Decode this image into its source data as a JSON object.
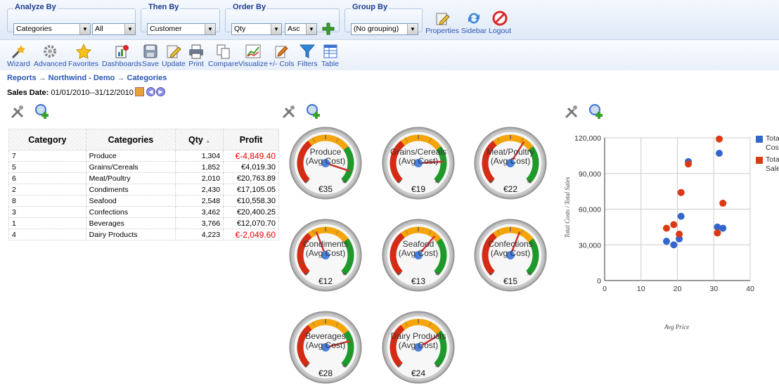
{
  "toolbar": {
    "analyze_by": {
      "title": "Analyze By",
      "value1": "Categories",
      "value2": "All"
    },
    "then_by": {
      "title": "Then By",
      "value": "Customer"
    },
    "order_by": {
      "title": "Order By",
      "value": "Qty",
      "dir": "Asc"
    },
    "group_by": {
      "title": "Group By",
      "value": "(No grouping)"
    },
    "properties": "Properties",
    "sidebar": "Sidebar",
    "logout": "Logout"
  },
  "actions": [
    "Wizard",
    "Advanced",
    "Favorites",
    "Dashboards",
    "Save",
    "Update",
    "Print",
    "Compare",
    "Visualize",
    "+/- Cols",
    "Filters",
    "Table"
  ],
  "breadcrumb": "Reports → Northwind - Demo → Categories",
  "sales_date": {
    "label": "Sales Date:",
    "value": "01/01/2010--31/12/2010"
  },
  "table": {
    "headers": [
      "Category",
      "Categories",
      "Qty",
      "Profit"
    ],
    "rows": [
      {
        "id": "7",
        "name": "Produce",
        "qty": "1,304",
        "profit": "€-4,849.40"
      },
      {
        "id": "5",
        "name": "Grains/Cereals",
        "qty": "1,852",
        "profit": "€4,019.30"
      },
      {
        "id": "6",
        "name": "Meat/Poultry",
        "qty": "2,010",
        "profit": "€20,763.89"
      },
      {
        "id": "2",
        "name": "Condiments",
        "qty": "2,430",
        "profit": "€17,105.05"
      },
      {
        "id": "8",
        "name": "Seafood",
        "qty": "2,548",
        "profit": "€10,558.30"
      },
      {
        "id": "3",
        "name": "Confections",
        "qty": "3,462",
        "profit": "€20,400.25"
      },
      {
        "id": "1",
        "name": "Beverages",
        "qty": "3,766",
        "profit": "€12,070.70"
      },
      {
        "id": "4",
        "name": "Dairy Products",
        "qty": "4,223",
        "profit": "€-2,049.60"
      }
    ]
  },
  "gauges": [
    {
      "name": "Produce",
      "sub": "(Avg Cost)",
      "value": "€35",
      "max": "35",
      "frac": 0.9
    },
    {
      "name": "Grains/Cereals",
      "sub": "(Avg Cost)",
      "value": "€19",
      "max": "21",
      "frac": 0.82
    },
    {
      "name": "Meat/Poultry",
      "sub": "(Avg Cost)",
      "value": "€22",
      "max": "32",
      "frac": 0.62
    },
    {
      "name": "Condiments",
      "sub": "(Avg Cost)",
      "value": "€12",
      "max": "19",
      "frac": 0.42
    },
    {
      "name": "Seafood",
      "sub": "(Avg Cost)",
      "value": "€13",
      "max": "17",
      "frac": 0.65
    },
    {
      "name": "Confections",
      "sub": "(Avg Cost)",
      "value": "€15",
      "max": "21",
      "frac": 0.58
    },
    {
      "name": "Beverages",
      "sub": "(Avg Cost)",
      "value": "€28",
      "max": "32",
      "frac": 0.78
    },
    {
      "name": "Dairy Products",
      "sub": "(Avg Cost)",
      "value": "€24",
      "max": "32",
      "frac": 0.72
    }
  ],
  "chart_data": {
    "type": "scatter",
    "xlabel": "Avg Price",
    "ylabel": "Total Costs / Total Sales",
    "xlim": [
      0,
      40
    ],
    "ylim": [
      0,
      120000
    ],
    "xticks": [
      "0",
      "10",
      "20",
      "30",
      "40"
    ],
    "yticks": [
      "0",
      "30,000",
      "60,000",
      "90,000",
      "120,000"
    ],
    "legend": [
      "Tota Cos",
      "Tota Sale"
    ],
    "series": [
      {
        "name": "Total Cost",
        "color": "#3366cc",
        "points": [
          [
            17,
            33000
          ],
          [
            19,
            30000
          ],
          [
            20.5,
            35000
          ],
          [
            21,
            54000
          ],
          [
            23,
            100000
          ],
          [
            31.5,
            107000
          ],
          [
            31,
            45000
          ],
          [
            32.5,
            44000
          ]
        ]
      },
      {
        "name": "Total Sales",
        "color": "#dc3912",
        "points": [
          [
            17,
            44000
          ],
          [
            19,
            47000
          ],
          [
            20.5,
            39000
          ],
          [
            21,
            74000
          ],
          [
            23,
            98000
          ],
          [
            31.5,
            119000
          ],
          [
            31,
            40000
          ],
          [
            32.5,
            65000
          ]
        ]
      }
    ]
  }
}
